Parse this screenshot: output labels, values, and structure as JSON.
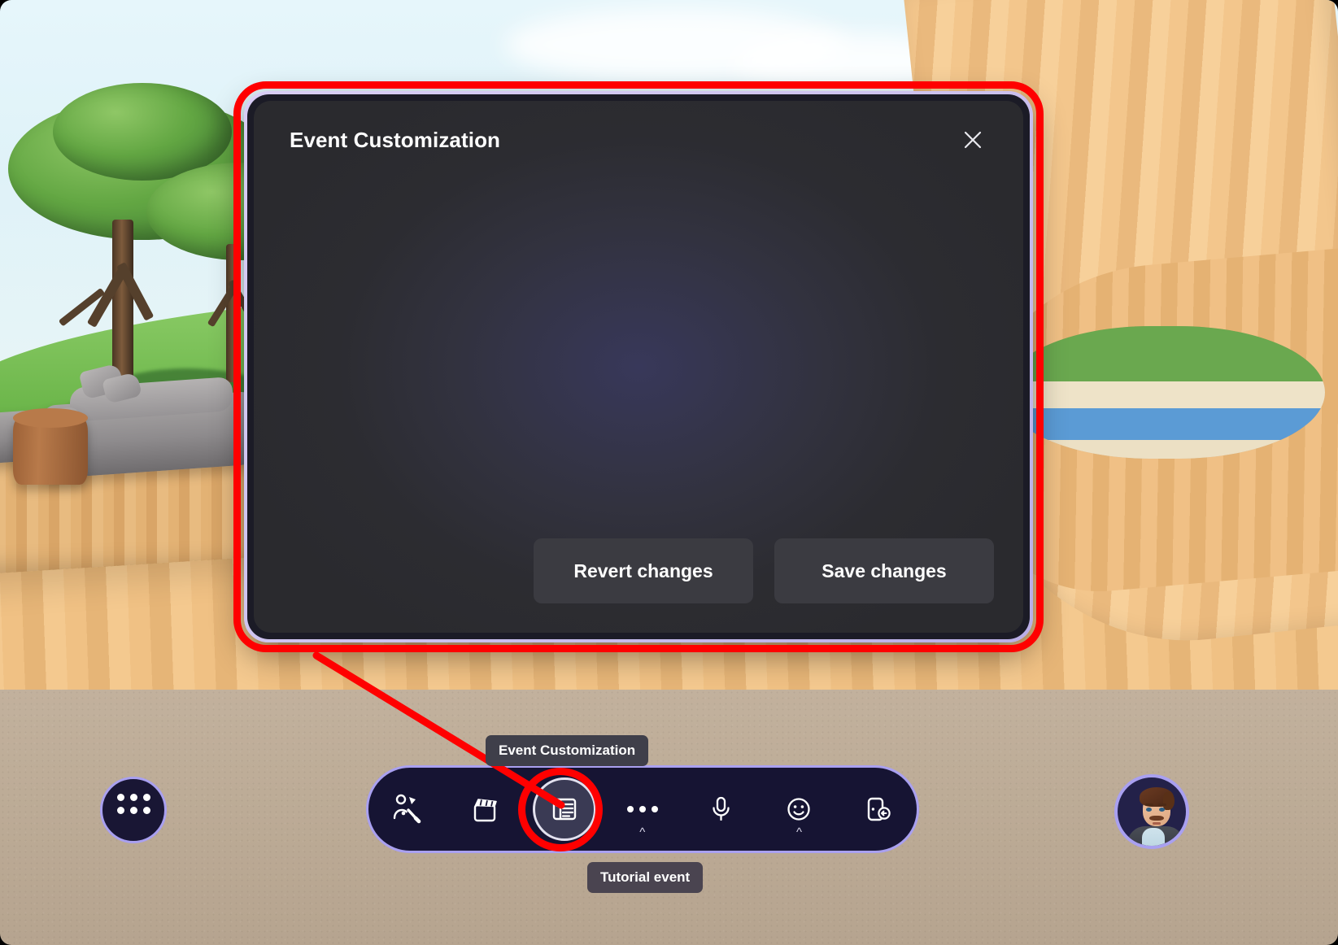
{
  "app": {
    "environment_name": "Immersive 3D virtual space",
    "scene_description": "Outdoor wooden lounge with trees, sofa, stool and water view"
  },
  "dialog": {
    "title": "Event Customization",
    "close_label": "Close",
    "body_text": "",
    "buttons": [
      {
        "label": "Revert changes",
        "name": "revert-changes-button"
      },
      {
        "label": "Save changes",
        "name": "save-changes-button"
      }
    ]
  },
  "tooltips": {
    "event_customization": "Event Customization",
    "tutorial_event": "Tutorial event"
  },
  "bottom_bar": {
    "apps_button": {
      "label": "Apps",
      "icon": "grid-dots-icon"
    },
    "toolbar_items": [
      {
        "label": "Reactions",
        "icon": "reactions-icon",
        "has_chevron": false,
        "active": false
      },
      {
        "label": "Video effects",
        "icon": "clapperboard-icon",
        "has_chevron": false,
        "active": false
      },
      {
        "label": "Event Customization",
        "icon": "event-customization-icon",
        "has_chevron": false,
        "active": true
      },
      {
        "label": "More options",
        "icon": "more-horizontal-icon",
        "has_chevron": true,
        "active": false
      },
      {
        "label": "Microphone",
        "icon": "microphone-icon",
        "has_chevron": false,
        "active": false
      },
      {
        "label": "Emoji",
        "icon": "smiley-icon",
        "has_chevron": true,
        "active": false
      },
      {
        "label": "Leave",
        "icon": "leave-door-icon",
        "has_chevron": false,
        "active": false
      }
    ],
    "avatar": {
      "label": "Your avatar",
      "icon": "avatar-icon"
    }
  },
  "annotations": {
    "highlight_color": "#ff0000",
    "highlight_targets": [
      "Event Customization dialog",
      "Event Customization toolbar button"
    ],
    "connector": "callout-line"
  },
  "colors": {
    "accent_border": "#a9a0f0",
    "dialog_bg": "#2c2c31",
    "dialog_frame": "#1b1b26",
    "toolbar_bg": "#161433",
    "button_bg": "#3b3b41",
    "highlight": "#ff0000",
    "text": "#ffffff"
  }
}
